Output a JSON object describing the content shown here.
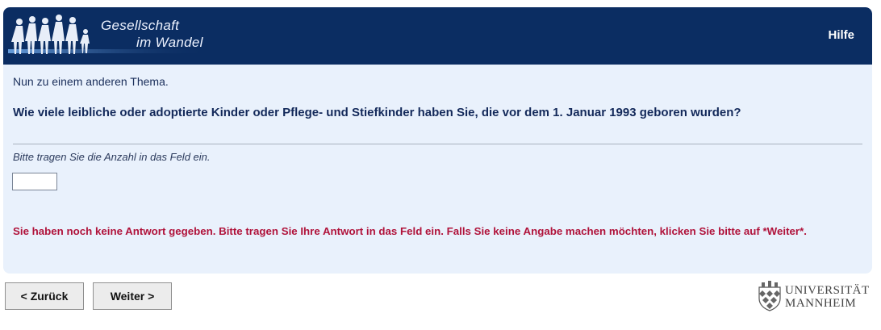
{
  "header": {
    "logo_line1": "Gesellschaft",
    "logo_line2": "im Wandel",
    "help_label": "Hilfe"
  },
  "survey": {
    "intro": "Nun zu einem anderen Thema.",
    "question": "Wie viele leibliche oder adoptierte Kinder oder Pflege- und Stiefkinder haben Sie, die vor dem 1. Januar 1993 geboren wurden?",
    "instruction": "Bitte tragen Sie die Anzahl in das Feld ein.",
    "answer_value": "",
    "error": "Sie haben noch keine Antwort gegeben. Bitte tragen Sie Ihre Antwort in das Feld ein. Falls Sie keine Angabe machen möchten, klicken Sie bitte auf *Weiter*."
  },
  "nav": {
    "back_label": "< Zurück",
    "next_label": "Weiter >"
  },
  "footer": {
    "uni_line1": "UNIVERSITÄT",
    "uni_line2": "MANNHEIM"
  },
  "colors": {
    "header_bg": "#0b2d62",
    "panel_bg": "#e9f1fc",
    "error_text": "#b0123a",
    "question_text": "#13295a"
  }
}
